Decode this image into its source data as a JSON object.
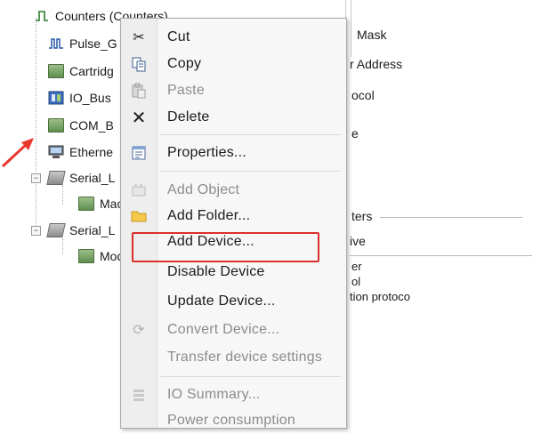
{
  "tree": {
    "items": [
      {
        "label": "Counters (Counters)",
        "icon": "counter-icon"
      },
      {
        "label": "Pulse_G",
        "icon": "pulse-icon"
      },
      {
        "label": "Cartridg",
        "icon": "module-icon"
      },
      {
        "label": "IO_Bus",
        "icon": "io-bus-icon"
      },
      {
        "label": "COM_B",
        "icon": "module-icon"
      },
      {
        "label": "Etherne",
        "icon": "ethernet-icon"
      },
      {
        "label": "Serial_L",
        "icon": "serial-line-icon"
      },
      {
        "label": "Mac",
        "icon": "module-icon"
      },
      {
        "label": "Serial_L",
        "icon": "serial-line-icon"
      },
      {
        "label": "Mod",
        "icon": "module-icon"
      }
    ]
  },
  "right_pane": {
    "lines": [
      {
        "text": "Mask"
      },
      {
        "text": "r Address"
      },
      {
        "text": "ocol"
      },
      {
        "text": "e"
      },
      {
        "text": "ters"
      },
      {
        "text": "ive"
      },
      {
        "text": "er"
      },
      {
        "text": "ol"
      },
      {
        "text": "tion protoco"
      }
    ]
  },
  "context_menu": {
    "items": [
      {
        "label": "Cut",
        "icon": "scissors-icon",
        "enabled": true
      },
      {
        "label": "Copy",
        "icon": "copy-icon",
        "enabled": true
      },
      {
        "label": "Paste",
        "icon": "paste-icon",
        "enabled": false
      },
      {
        "label": "Delete",
        "icon": "delete-x-icon",
        "enabled": true
      },
      {
        "label": "Properties...",
        "icon": "properties-icon",
        "enabled": true
      },
      {
        "label": "Add Object",
        "icon": "add-object-icon",
        "enabled": false
      },
      {
        "label": "Add Folder...",
        "icon": "folder-icon",
        "enabled": true
      },
      {
        "label": "Add Device...",
        "icon": "",
        "enabled": true,
        "highlighted": true
      },
      {
        "label": "Disable Device",
        "icon": "",
        "enabled": true
      },
      {
        "label": "Update Device...",
        "icon": "",
        "enabled": true
      },
      {
        "label": "Convert Device...",
        "icon": "convert-icon",
        "enabled": false
      },
      {
        "label": "Transfer device settings",
        "icon": "",
        "enabled": false
      },
      {
        "label": "IO Summary...",
        "icon": "io-summary-icon",
        "enabled": false
      },
      {
        "label": "Power consumption",
        "icon": "",
        "enabled": false
      }
    ]
  },
  "colors": {
    "highlight_border": "#d9302c",
    "arrow": "#e8382f",
    "disabled_text": "#8c8c8c"
  }
}
